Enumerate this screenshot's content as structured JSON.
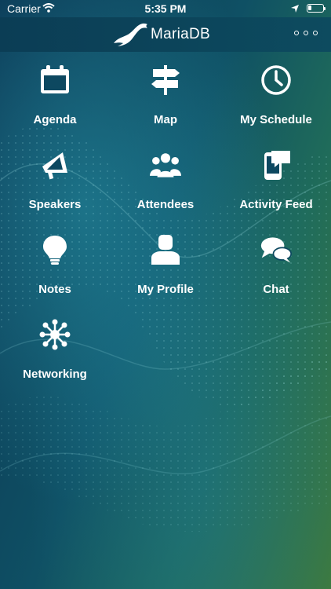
{
  "status_bar": {
    "carrier": "Carrier",
    "time": "5:35 PM",
    "battery_level": 0.25
  },
  "header": {
    "brand": "MariaDB",
    "more_icon": "more-dots-icon"
  },
  "menu": [
    {
      "label": "Agenda",
      "icon": "calendar-icon"
    },
    {
      "label": "Map",
      "icon": "signpost-icon"
    },
    {
      "label": "My Schedule",
      "icon": "clock-icon"
    },
    {
      "label": "Speakers",
      "icon": "megaphone-icon"
    },
    {
      "label": "Attendees",
      "icon": "people-group-icon"
    },
    {
      "label": "Activity Feed",
      "icon": "phone-chat-icon"
    },
    {
      "label": "Notes",
      "icon": "lightbulb-icon"
    },
    {
      "label": "My Profile",
      "icon": "person-icon"
    },
    {
      "label": "Chat",
      "icon": "chat-bubbles-icon"
    },
    {
      "label": "Networking",
      "icon": "network-icon"
    }
  ],
  "colors": {
    "header_bg": "#0b3d55",
    "bg_left": "#0a3552",
    "bg_right": "#3f7a3a",
    "text": "#ffffff"
  }
}
